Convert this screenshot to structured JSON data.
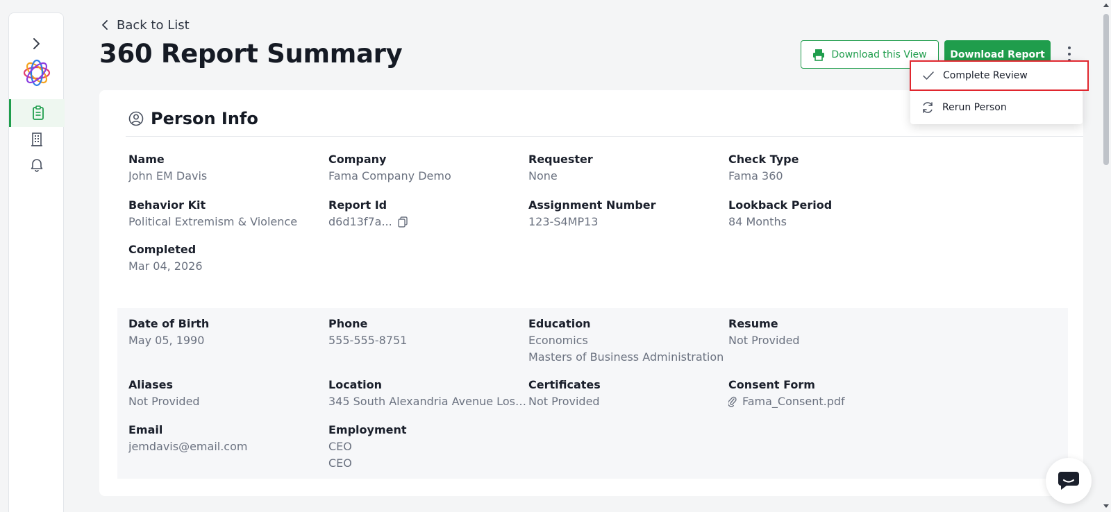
{
  "nav": {
    "back_label": "Back to List"
  },
  "page": {
    "title": "360 Report Summary"
  },
  "toolbar": {
    "download_view_label": "Download this View",
    "download_report_label": "Download Report"
  },
  "menu": {
    "items": [
      {
        "label": "Complete Review",
        "icon": "check-icon"
      },
      {
        "label": "Rerun Person",
        "icon": "refresh-icon"
      }
    ]
  },
  "section": {
    "title": "Person Info",
    "icon": "user-circle-icon"
  },
  "summary_fields": [
    {
      "label": "Name",
      "value": "John EM Davis"
    },
    {
      "label": "Company",
      "value": "Fama Company Demo"
    },
    {
      "label": "Requester",
      "value": "None"
    },
    {
      "label": "Check Type",
      "value": "Fama 360"
    },
    {
      "label": "Behavior Kit",
      "value": "Political Extremism & Violence"
    },
    {
      "label": "Report Id",
      "value": "d6d13f7a..."
    },
    {
      "label": "Assignment Number",
      "value": "123-S4MP13"
    },
    {
      "label": "Lookback Period",
      "value": "84 Months"
    },
    {
      "label": "Completed",
      "value": "Mar 04, 2026"
    }
  ],
  "detail_fields": [
    {
      "label": "Date of Birth",
      "values": [
        "May 05, 1990"
      ]
    },
    {
      "label": "Phone",
      "values": [
        "555-555-8751"
      ]
    },
    {
      "label": "Education",
      "values": [
        "Economics",
        "Masters of Business Administration"
      ]
    },
    {
      "label": "Resume",
      "values": [
        "Not Provided"
      ]
    },
    {
      "label": "Aliases",
      "values": [
        "Not Provided"
      ]
    },
    {
      "label": "Location",
      "values": [
        "345 South Alexandria Avenue Los ..."
      ]
    },
    {
      "label": "Certificates",
      "values": [
        "Not Provided"
      ]
    },
    {
      "label": "Consent Form",
      "values": [
        "Fama_Consent.pdf"
      ]
    },
    {
      "label": "Email",
      "values": [
        "jemdavis@email.com"
      ]
    },
    {
      "label": "Employment",
      "values": [
        "CEO",
        "CEO"
      ]
    }
  ],
  "colors": {
    "brand_green": "#1f9d4c",
    "highlight_red": "#e0262e"
  }
}
